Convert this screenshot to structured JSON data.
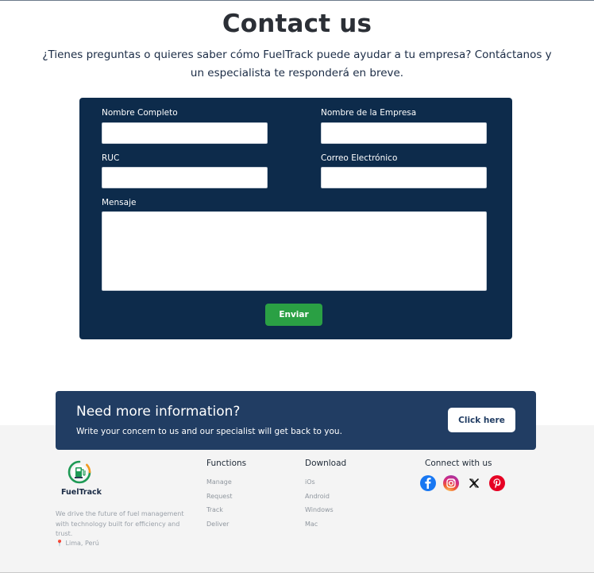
{
  "header": {
    "title": "Contact us",
    "subtitle": "¿Tienes preguntas o quieres saber cómo FuelTrack puede ayudar a tu empresa? Contáctanos y un especialista te responderá en breve."
  },
  "form": {
    "full_name_label": "Nombre Completo",
    "full_name_value": "",
    "company_label": "Nombre de la Empresa",
    "company_value": "",
    "ruc_label": "RUC",
    "ruc_value": "",
    "email_label": "Correo Electrónico",
    "email_value": "",
    "message_label": "Mensaje",
    "message_value": "",
    "submit_label": "Enviar"
  },
  "cta": {
    "title": "Need more information?",
    "text": "Write your concern to us and our specialist will get back to you.",
    "button_label": "Click here"
  },
  "footer": {
    "logo_text": "FuelTrack",
    "about": "We drive the future of fuel management with technology built for efficiency and trust.",
    "location": "Lima, Perú",
    "functions_title": "Functions",
    "functions": [
      "Manage",
      "Request",
      "Track",
      "Deliver"
    ],
    "download_title": "Download",
    "downloads": [
      "iOs",
      "Android",
      "Windows",
      "Mac"
    ],
    "connect_title": "Connect with us",
    "socials": [
      "facebook-icon",
      "instagram-icon",
      "x-icon",
      "pinterest-icon"
    ]
  },
  "colors": {
    "form_bg": "#0d2b4b",
    "submit_green": "#2aa044",
    "cta_bg": "#213d63",
    "footer_bg": "#f4f4f4"
  }
}
